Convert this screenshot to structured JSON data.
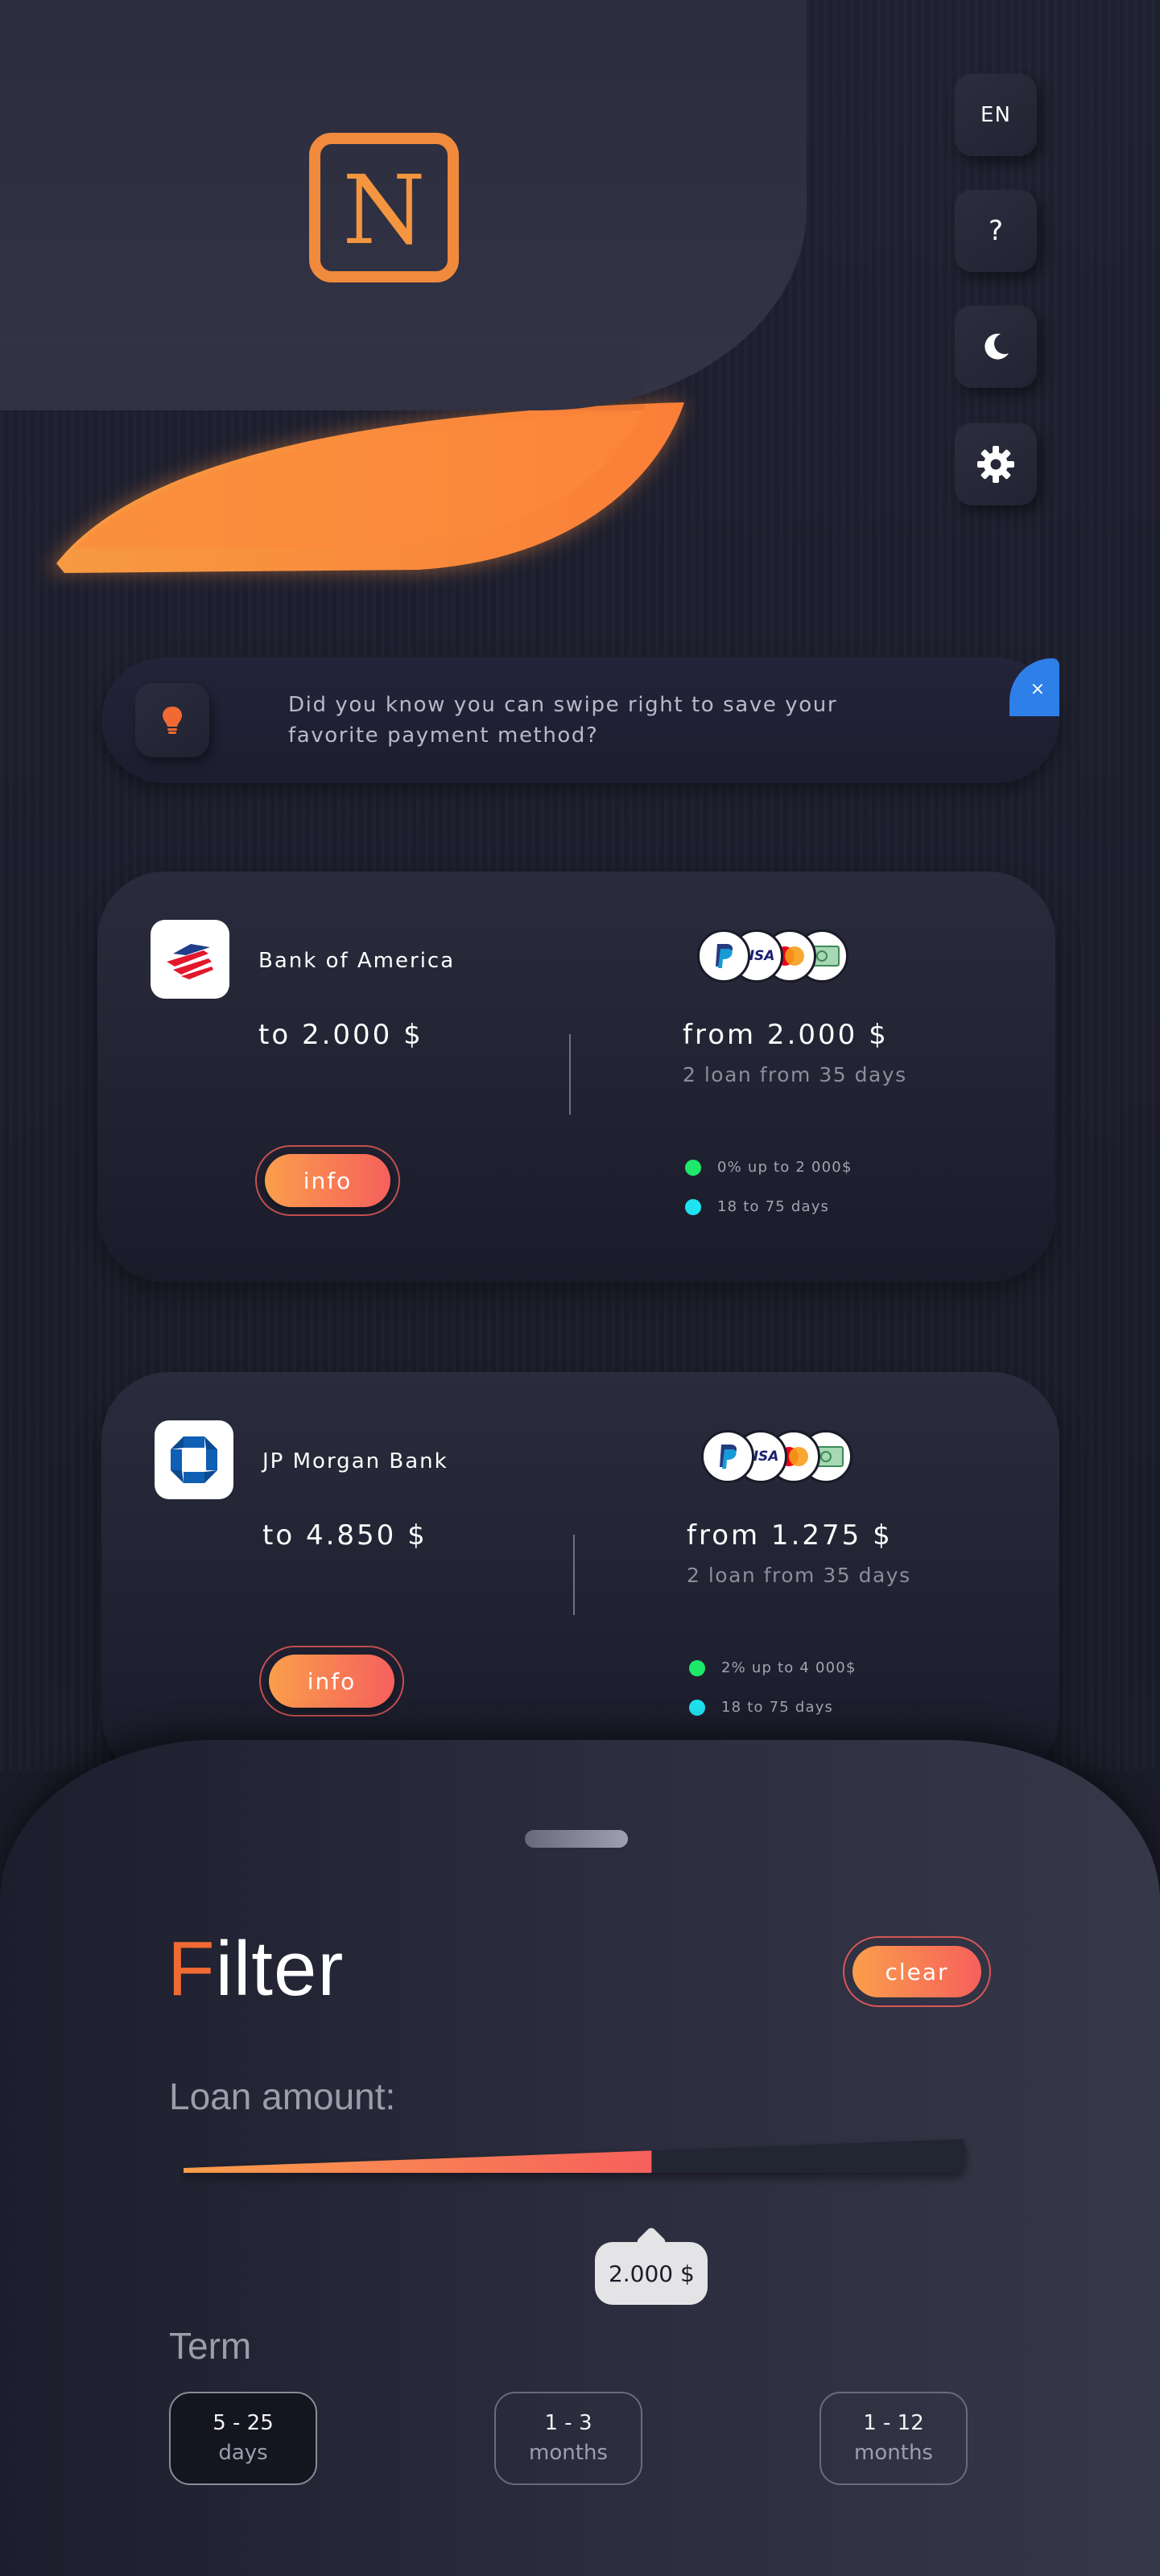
{
  "header": {
    "logo_letter": "N",
    "language": "EN",
    "help": "?"
  },
  "icons": {
    "language": "language-icon",
    "help": "help-icon",
    "theme": "moon-icon",
    "settings": "gear-icon",
    "tip": "lightbulb-icon",
    "close": "close-icon"
  },
  "colors": {
    "accent_orange": "#f08a3c",
    "gradient_start": "#fa9e4c",
    "gradient_end": "#f6605c",
    "close_blue": "#2f7fe8",
    "dot_green": "#1ee86a",
    "dot_cyan": "#1fe2f2"
  },
  "tip": {
    "text": "Did you know you can swipe right to save your favorite payment method?",
    "close": "×"
  },
  "cards": [
    {
      "bank": "Bank of America",
      "to_amount": "to 2.000 $",
      "from_amount": "from 2.000 $",
      "loan_terms": "2 loan from 35 days",
      "info_label": "info",
      "features": [
        "0% up to 2 000$",
        "18 to 75 days"
      ]
    },
    {
      "bank": "JP Morgan Bank",
      "to_amount": "to 4.850 $",
      "from_amount": "from 1.275 $",
      "loan_terms": "2 loan from 35 days",
      "info_label": "info",
      "features": [
        "2% up to 4 000$",
        "18 to 75 days"
      ]
    }
  ],
  "payment_methods": [
    "PayPal",
    "VISA",
    "Mastercard",
    "Cash"
  ],
  "filter": {
    "title_first": "F",
    "title_rest": "ilter",
    "clear_label": "clear",
    "loan_amount_label": "Loan amount:",
    "loan_amount_value": "2.000 $",
    "loan_amount_fraction": 0.6,
    "term_label": "Term",
    "terms": [
      {
        "top": "5 - 25",
        "bottom": "days",
        "selected": true
      },
      {
        "top": "1 - 3",
        "bottom": "months",
        "selected": false
      },
      {
        "top": "1 - 12",
        "bottom": "months",
        "selected": false
      }
    ]
  }
}
